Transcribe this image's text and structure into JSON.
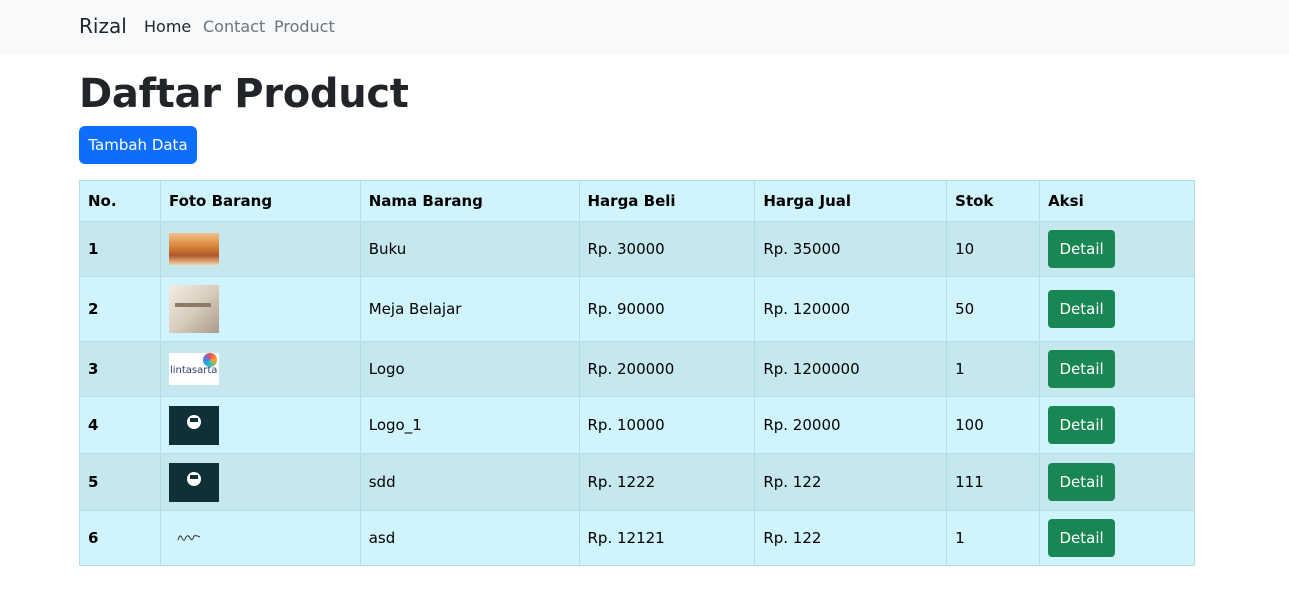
{
  "navbar": {
    "brand": "Rizal",
    "links": [
      {
        "label": "Home",
        "active": true
      },
      {
        "label": "Contact",
        "active": false
      },
      {
        "label": "Product",
        "active": false
      }
    ]
  },
  "main": {
    "title": "Daftar Product",
    "add_button_label": "Tambah Data"
  },
  "table": {
    "headers": [
      "No.",
      "Foto Barang",
      "Nama Barang",
      "Harga Beli",
      "Harga Jual",
      "Stok",
      "Aksi"
    ],
    "rows": [
      {
        "no": "1",
        "foto": "books-photo",
        "nama": "Buku",
        "beli": "Rp. 30000",
        "jual": "Rp. 35000",
        "stok": "10",
        "aksi": "Detail"
      },
      {
        "no": "2",
        "foto": "desk-photo",
        "nama": "Meja Belajar",
        "beli": "Rp. 90000",
        "jual": "Rp. 120000",
        "stok": "50",
        "aksi": "Detail"
      },
      {
        "no": "3",
        "foto": "lintasarta-logo",
        "nama": "Logo",
        "beli": "Rp. 200000",
        "jual": "Rp. 1200000",
        "stok": "1",
        "aksi": "Detail"
      },
      {
        "no": "4",
        "foto": "dark-m-logo",
        "nama": "Logo_1",
        "beli": "Rp. 10000",
        "jual": "Rp. 20000",
        "stok": "100",
        "aksi": "Detail"
      },
      {
        "no": "5",
        "foto": "dark-m-logo",
        "nama": "sdd",
        "beli": "Rp. 1222",
        "jual": "Rp. 122",
        "stok": "111",
        "aksi": "Detail"
      },
      {
        "no": "6",
        "foto": "signature-image",
        "nama": "asd",
        "beli": "Rp. 12121",
        "jual": "Rp. 122",
        "stok": "1",
        "aksi": "Detail"
      }
    ],
    "logo_text": "lintasarta"
  },
  "colors": {
    "primary": "#0d6efd",
    "success": "#198754",
    "table_bg": "#cff4fc",
    "table_stripe": "#c5e8ef"
  }
}
